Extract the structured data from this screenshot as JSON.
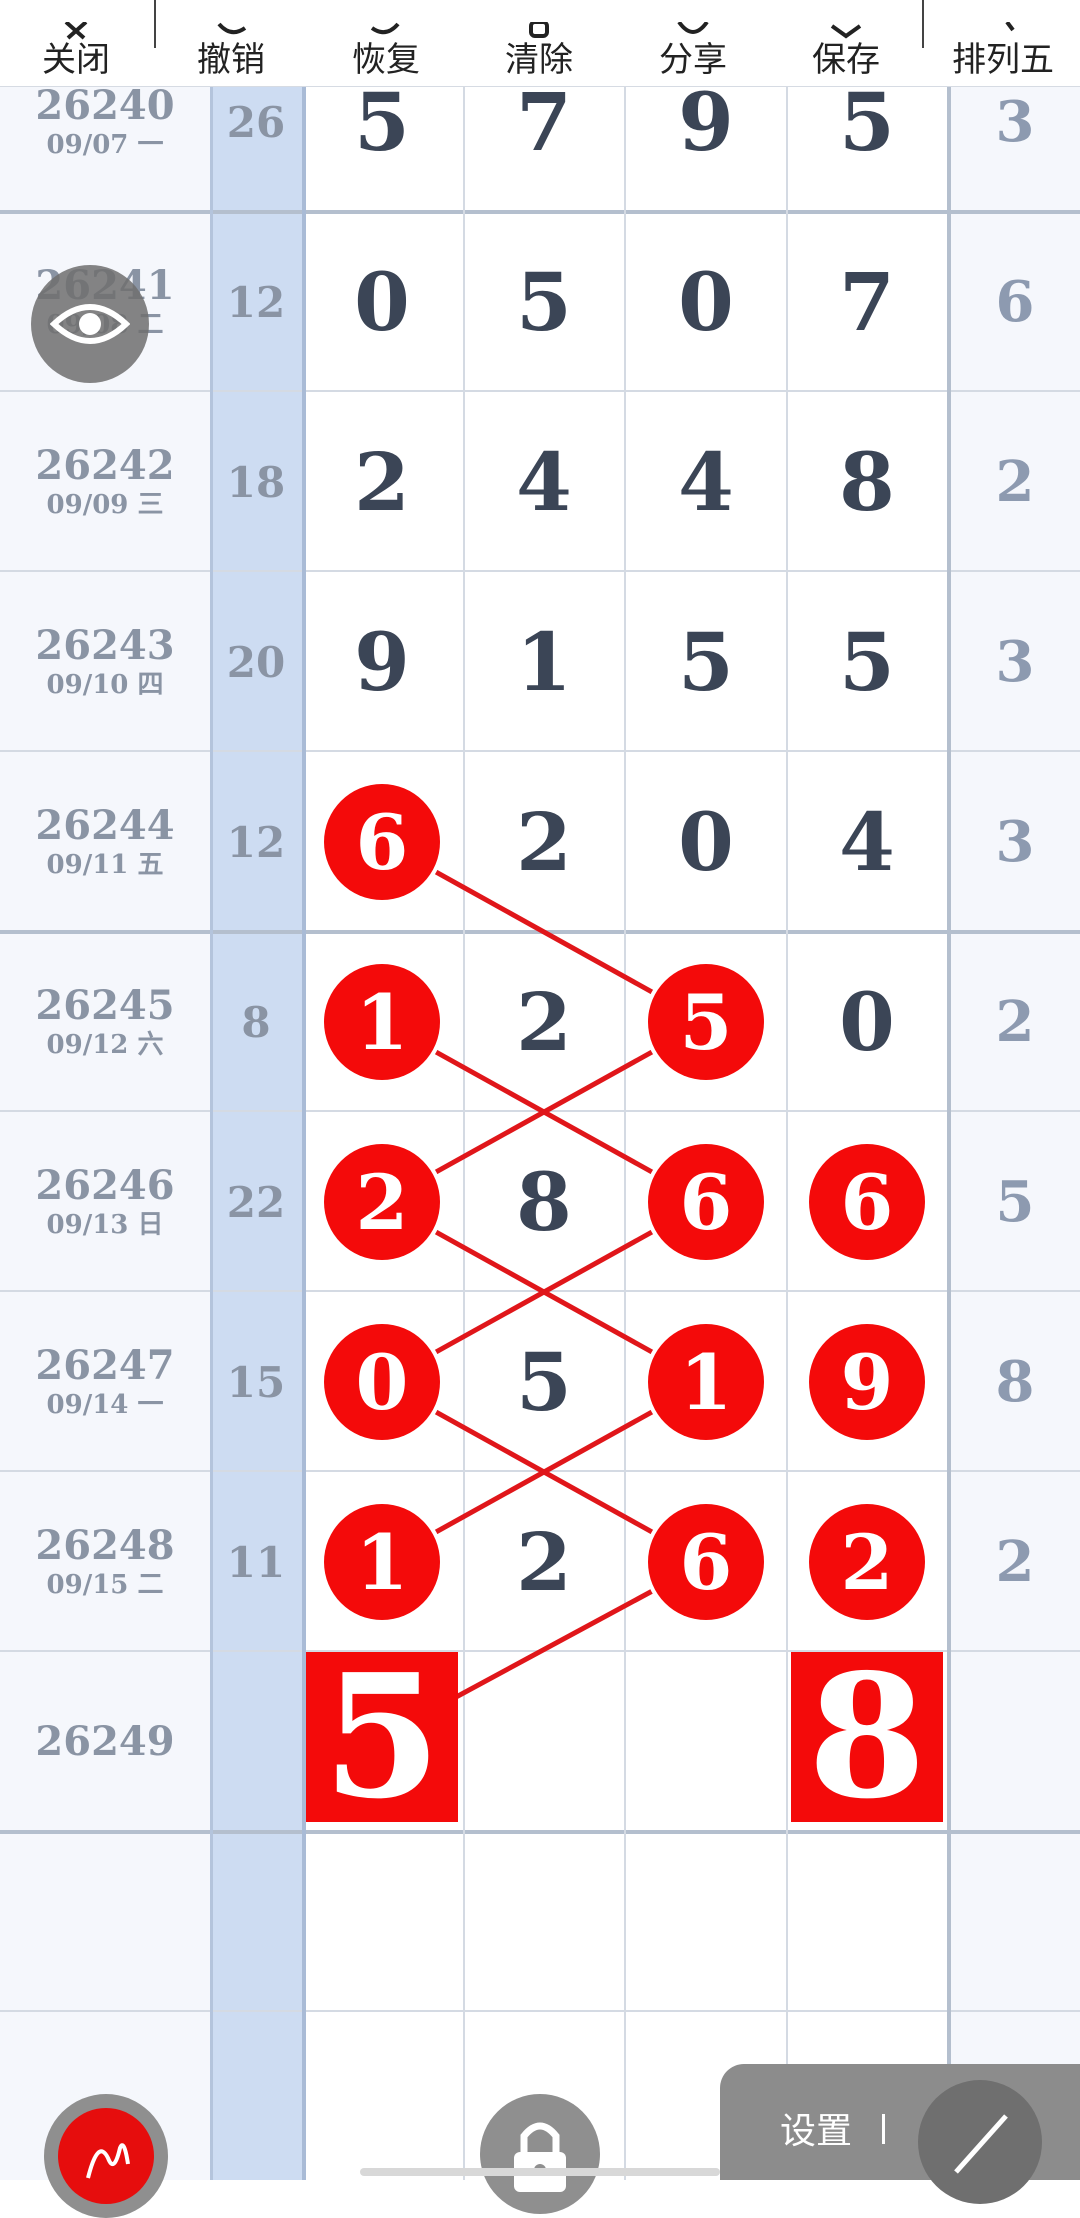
{
  "toolbar": {
    "items": [
      {
        "label": "关闭",
        "icon": "close-icon"
      },
      {
        "label": "撤销",
        "icon": "undo-icon"
      },
      {
        "label": "恢复",
        "icon": "redo-icon"
      },
      {
        "label": "清除",
        "icon": "clear-icon"
      },
      {
        "label": "分享",
        "icon": "share-icon"
      },
      {
        "label": "保存",
        "icon": "save-icon"
      },
      {
        "label": "排列五",
        "icon": "chevron-down-icon"
      }
    ]
  },
  "rows": [
    {
      "issue": "26240",
      "date": "09/07 一",
      "sum": "26",
      "digits": [
        "5",
        "7",
        "9",
        "5"
      ],
      "last": "3"
    },
    {
      "issue": "26241",
      "date": "09/08 二",
      "sum": "12",
      "digits": [
        "0",
        "5",
        "0",
        "7"
      ],
      "last": "6"
    },
    {
      "issue": "26242",
      "date": "09/09 三",
      "sum": "18",
      "digits": [
        "2",
        "4",
        "4",
        "8"
      ],
      "last": "2"
    },
    {
      "issue": "26243",
      "date": "09/10 四",
      "sum": "20",
      "digits": [
        "9",
        "1",
        "5",
        "5"
      ],
      "last": "3"
    },
    {
      "issue": "26244",
      "date": "09/11 五",
      "sum": "12",
      "digits": [
        "6",
        "2",
        "0",
        "4"
      ],
      "last": "3"
    },
    {
      "issue": "26245",
      "date": "09/12 六",
      "sum": "8",
      "digits": [
        "1",
        "2",
        "5",
        "0"
      ],
      "last": "2"
    },
    {
      "issue": "26246",
      "date": "09/13 日",
      "sum": "22",
      "digits": [
        "2",
        "8",
        "6",
        "6"
      ],
      "last": "5"
    },
    {
      "issue": "26247",
      "date": "09/14 一",
      "sum": "15",
      "digits": [
        "0",
        "5",
        "1",
        "9"
      ],
      "last": "8"
    },
    {
      "issue": "26248",
      "date": "09/15 二",
      "sum": "11",
      "digits": [
        "1",
        "2",
        "6",
        "2"
      ],
      "last": "2"
    }
  ],
  "next_issue": {
    "issue": "26249",
    "predictions": [
      "5",
      "8"
    ]
  },
  "floating": {
    "eye_icon": "eye-icon",
    "pen_icon": "pen-icon",
    "lock_icon": "lock-icon",
    "settings_label": "设置",
    "settings_sep": "|",
    "edit_icon": "pencil-line-icon"
  },
  "colors": {
    "accent_red": "#f40a0a",
    "sum_column_blue": "#cddcf2",
    "digit_text": "#3b4556",
    "muted_text": "#8a94a4"
  }
}
